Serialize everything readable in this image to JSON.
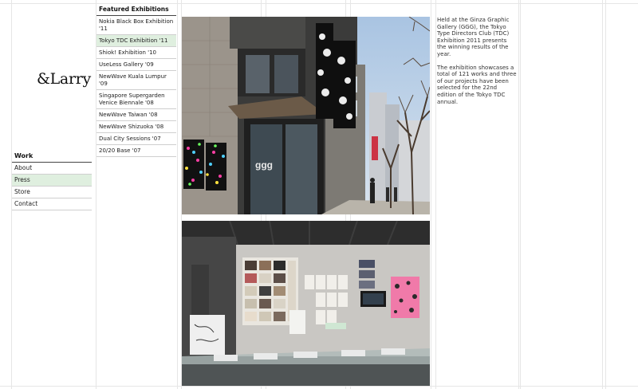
{
  "logo": "&Larry",
  "nav": {
    "heading": "Work",
    "items": [
      {
        "label": "About",
        "active": false
      },
      {
        "label": "Press",
        "active": true
      },
      {
        "label": "Store",
        "active": false
      },
      {
        "label": "Contact",
        "active": false
      }
    ]
  },
  "exhibitions": {
    "heading": "Featured Exhibitions",
    "items": [
      {
        "label": "Nokia Black Box Exhibition '11"
      },
      {
        "label": "Tokyo TDC Exhibition '11"
      },
      {
        "label": "Shiok! Exhibition '10"
      },
      {
        "label": "UseLess Gallery '09"
      },
      {
        "label": "NewWave Kuala Lumpur '09"
      },
      {
        "label": "Singapore Supergarden Venice Biennale '08"
      },
      {
        "label": "NewWave Taiwan '08"
      },
      {
        "label": "NewWave Shizuoka '08"
      },
      {
        "label": "Dual City Sessions '07"
      },
      {
        "label": "20/20 Base '07"
      }
    ]
  },
  "description": {
    "p1": "Held at the Ginza Graphic Gallery (GGG), the Tokyo Type Directors Club (TDC) Exhibition 2011 presents the winning results of the year.",
    "p2": "The exhibition showcases a total of 121 works and three of our projects have been selected for the 22nd edition of the Tokyo TDC annual."
  },
  "photos": [
    {
      "subject": "exterior-gallery-facade"
    },
    {
      "subject": "interior-exhibition-room"
    }
  ],
  "colors": {
    "active_bg": "#dfefdf",
    "grid_line": "#e6e6e6"
  }
}
